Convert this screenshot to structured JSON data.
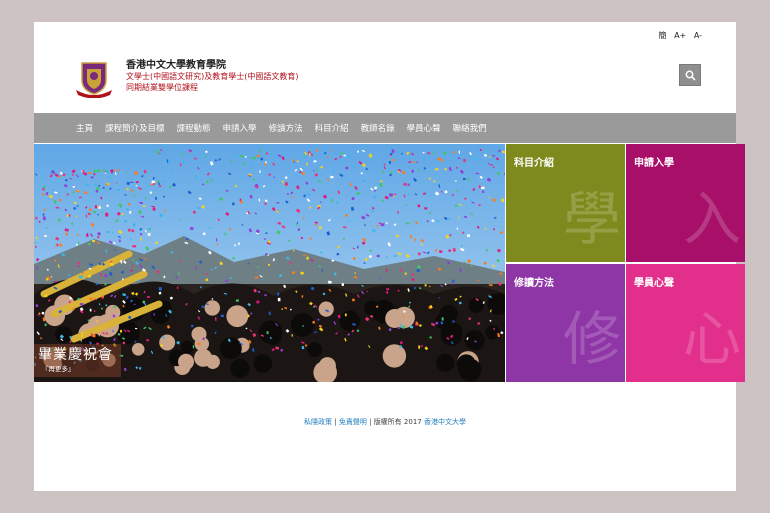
{
  "header": {
    "lang": {
      "simplified": "簡",
      "font_up": "A+",
      "font_down": "A-"
    },
    "school_name": "香港中文大學教育學院",
    "program_line1": "文學士(中國語文研究)及教育學士(中國語文教育)",
    "program_line2": "同期結業雙學位課程",
    "search_icon": "search-icon"
  },
  "nav": {
    "items": [
      "主頁",
      "課程簡介及目標",
      "課程動態",
      "申請入學",
      "修讀方法",
      "科目介紹",
      "教師名錄",
      "學員心聲",
      "聯絡我們"
    ]
  },
  "hero": {
    "title": "畢業慶祝會",
    "more": "『再更多』"
  },
  "tiles": {
    "subjects": {
      "label": "科目介紹",
      "char": "學",
      "color": "#7e8a1e"
    },
    "apply": {
      "label": "申請入學",
      "char": "入",
      "color": "#a70f68"
    },
    "study": {
      "label": "修讀方法",
      "char": "修",
      "color": "#8e36a6"
    },
    "voice": {
      "label": "學員心聲",
      "char": "心",
      "color": "#e22f8b"
    }
  },
  "footer": {
    "privacy": "私隱政策",
    "disclaimer": "免責聲明",
    "copyright": "版權所有 2017",
    "university": "香港中文大學"
  }
}
